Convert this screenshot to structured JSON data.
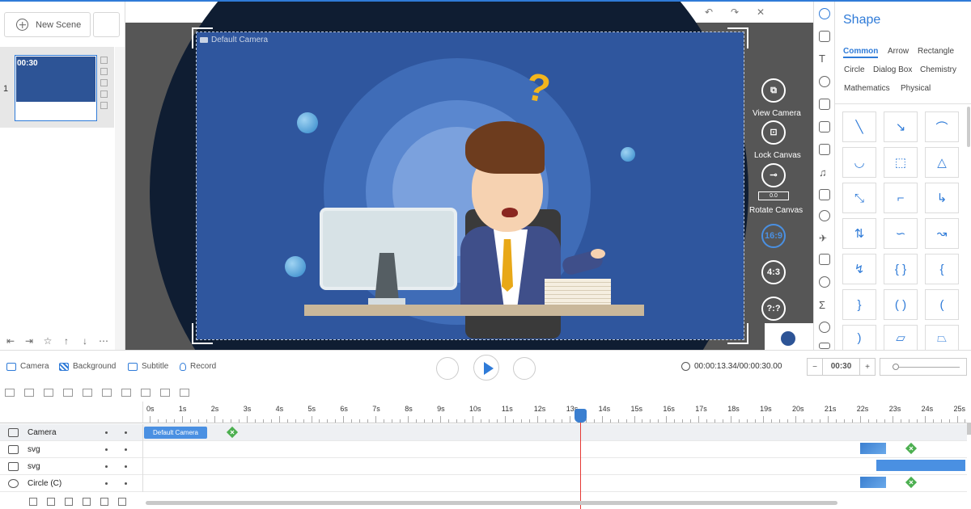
{
  "scenes": {
    "new_scene_label": "New Scene",
    "items": [
      {
        "number": "1",
        "duration": "00:30"
      }
    ]
  },
  "stage": {
    "camera_label": "Default Camera",
    "tools": {
      "view_camera": "View Camera",
      "lock_canvas": "Lock Canvas",
      "rotate_canvas": "Rotate Canvas",
      "rotate_value": "0.0",
      "ratio_16_9": "16:9",
      "ratio_4_3": "4:3",
      "ratio_custom": "?:?"
    },
    "question_mark": "?"
  },
  "shape_panel": {
    "title": "Shape",
    "categories": [
      "Common",
      "Arrow",
      "Rectangle",
      "Circle",
      "Dialog Box",
      "Chemistry",
      "Mathematics",
      "Physical"
    ],
    "selected_category": "Common"
  },
  "toolbar": {
    "camera": "Camera",
    "background": "Background",
    "subtitle": "Subtitle",
    "record": "Record"
  },
  "playback": {
    "time_readout": "00:00:13.34/00:00:30.00",
    "duration": "00:30",
    "minus": "−",
    "plus": "+"
  },
  "timeline": {
    "ticks": [
      "0s",
      "1s",
      "2s",
      "3s",
      "4s",
      "5s",
      "6s",
      "7s",
      "8s",
      "9s",
      "10s",
      "11s",
      "12s",
      "13s",
      "14s",
      "15s",
      "16s",
      "17s",
      "18s",
      "19s",
      "20s",
      "21s",
      "22s",
      "23s",
      "24s",
      "25s"
    ],
    "current_time_s": 13.34,
    "layers": [
      {
        "name": "Camera",
        "clip_label": "Default Camera"
      },
      {
        "name": "svg"
      },
      {
        "name": "svg"
      },
      {
        "name": "Circle (C)"
      }
    ]
  },
  "colors": {
    "accent": "#2f7bd8",
    "canvas_bg": "#2f569e",
    "keyframe": "#4caf50",
    "playhead": "#e53935"
  }
}
